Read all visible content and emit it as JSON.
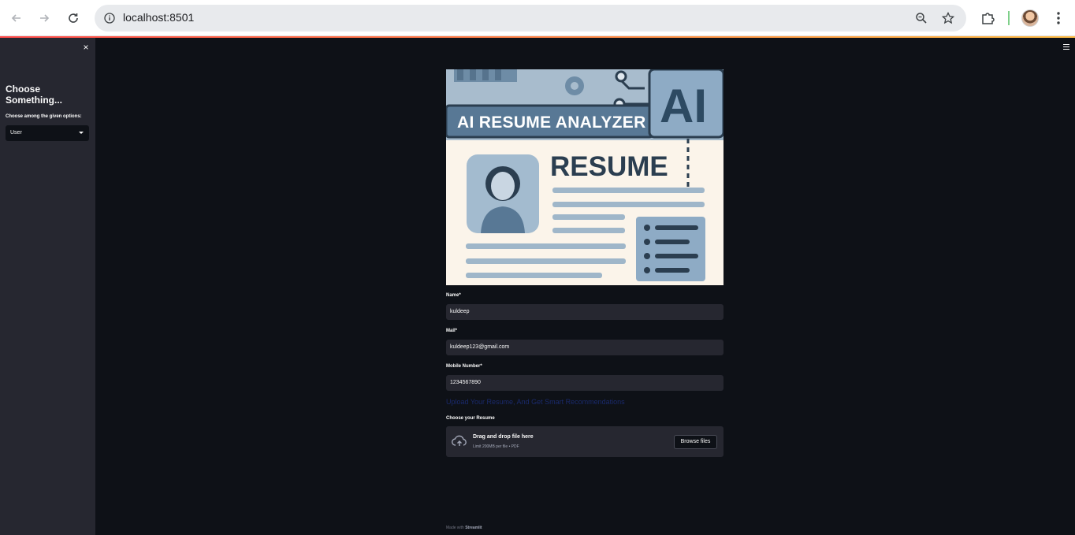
{
  "browser": {
    "url": "localhost:8501"
  },
  "sidebar": {
    "close_symbol": "×",
    "title": "Choose Something...",
    "select_label": "Choose among the given options:",
    "select_value": "User"
  },
  "banner": {
    "title": "AI RESUME ANALYZER",
    "ai_text": "AI",
    "resume_text": "RESUME"
  },
  "form": {
    "name_label": "Name*",
    "name_value": "kuldeep",
    "mail_label": "Mail*",
    "mail_value": "kuldeep123@gmail.com",
    "mobile_label": "Mobile Number*",
    "mobile_value": "1234567890",
    "upload_heading": "Upload Your Resume, And Get Smart Recommendations",
    "uploader_label": "Choose your Resume",
    "drop_title": "Drag and drop file here",
    "drop_limit": "Limit 200MB per file • PDF",
    "browse_label": "Browse files"
  },
  "footer": {
    "prefix": "Made with",
    "brand": "Streamlit"
  },
  "colors": {
    "background": "#0e1117",
    "sidebar": "#262730",
    "input": "#262730",
    "accent": "#ff4b4b"
  },
  "icons": [
    "back-arrow-icon",
    "forward-arrow-icon",
    "reload-icon",
    "site-info-icon",
    "zoom-icon",
    "bookmark-star-icon",
    "extensions-icon",
    "menu-dots-icon",
    "close-icon",
    "chevron-down-icon",
    "hamburger-icon",
    "cloud-upload-icon"
  ]
}
